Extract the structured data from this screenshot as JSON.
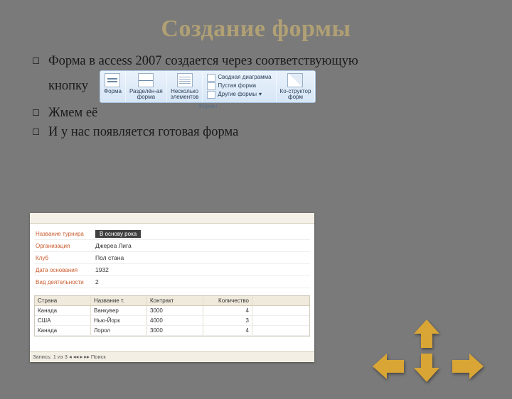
{
  "title": "Создание формы",
  "bullets": {
    "b1_line1": "Форма в access 2007 создается через соответствующую",
    "b1_line2": "кнопку",
    "b2": "Жмем её",
    "b3": "И у нас появляется готовая форма"
  },
  "ribbon": {
    "group_caption": "Формы",
    "items": {
      "form": "Форма",
      "split1": "Разделён-ая",
      "split2": "форма",
      "multi1": "Несколько",
      "multi2": "элементов",
      "wiz1": "Ко-структор",
      "wiz2": "форм"
    },
    "menu": {
      "m1": "Сводная диаграмма",
      "m2": "Пустая форма",
      "m3": "Другие формы"
    }
  },
  "form": {
    "header_value": "В основу рока",
    "fields": [
      {
        "label": "Название турнира",
        "value_dark": true,
        "value": "В основу рока"
      },
      {
        "label": "Организация",
        "value": "Джереа Лига"
      },
      {
        "label": "Клуб",
        "value": "Пол стана"
      },
      {
        "label": "Дата основания",
        "value": "1932"
      },
      {
        "label": "Вид деятельности",
        "value": "2"
      }
    ],
    "grid": {
      "headers": [
        "Страна",
        "Название т.",
        "Контракт",
        "Количество"
      ],
      "rows": [
        [
          "Канада",
          "Ванкувер",
          "3000",
          "4"
        ],
        [
          "США",
          "Нью-Йорк",
          "4000",
          "3"
        ],
        [
          "Канада",
          "Лорол",
          "3000",
          "4"
        ]
      ]
    },
    "nav": "Запись: 1 из 3   ◂ ◂◂ ▸ ▸▸   Поиск"
  },
  "arrows": {
    "color": "#d9a534"
  }
}
